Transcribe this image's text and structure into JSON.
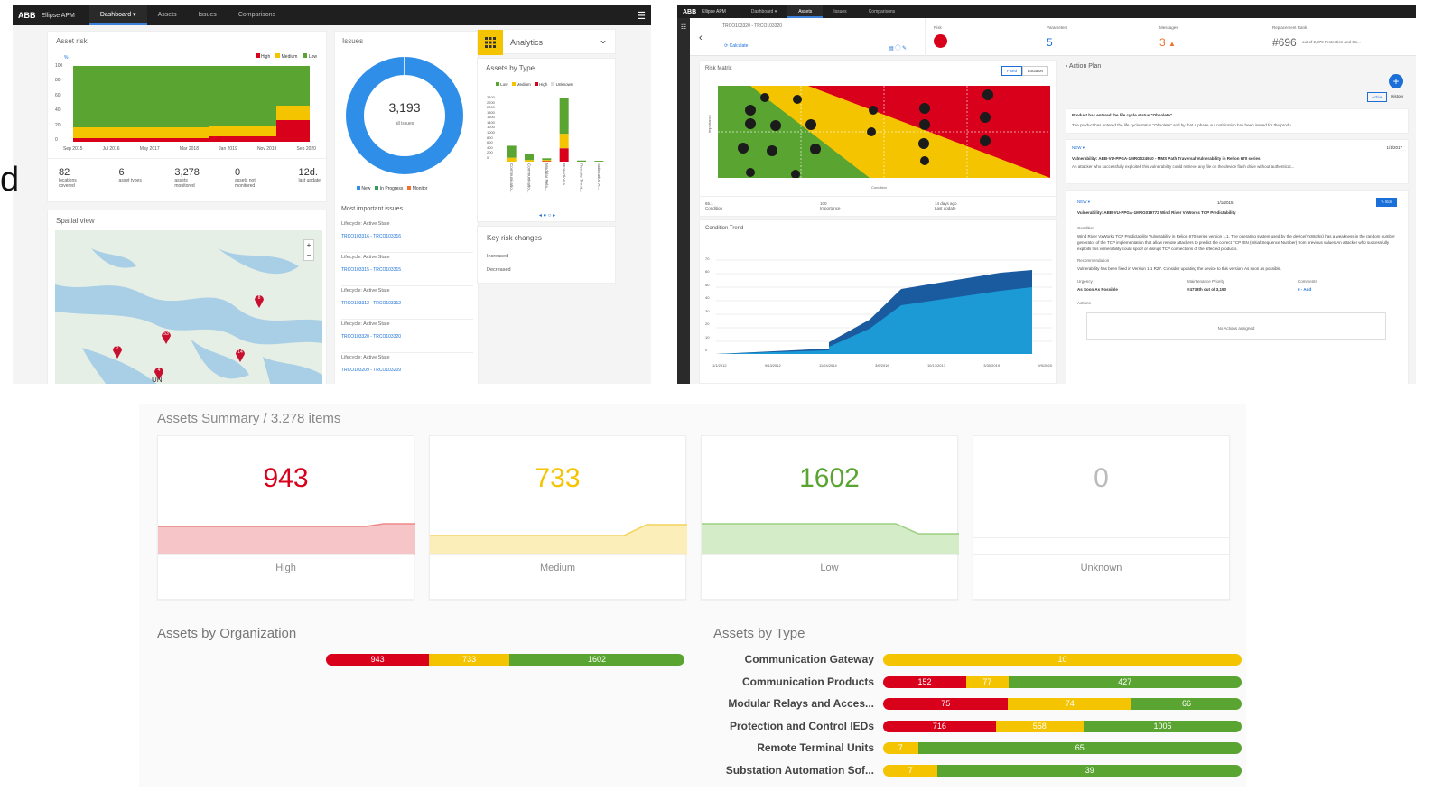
{
  "left": {
    "nav": {
      "logo": "ABB",
      "app": "Ellipse APM",
      "tabs": [
        "Dashboard ▾",
        "Assets",
        "Issues",
        "Comparisons"
      ],
      "menu": "☰"
    },
    "edge_text": "d",
    "asset_risk": {
      "title": "Asset risk",
      "yunit": "%",
      "legend": [
        "High",
        "Medium",
        "Low"
      ],
      "yticks": [
        "100",
        "80",
        "60",
        "40",
        "20",
        "0"
      ],
      "xticks": [
        "Sep 2015",
        "Jul 2016",
        "May 2017",
        "Mar 2018",
        "Jan 2019",
        "Nov 2019",
        "Sep 2020"
      ]
    },
    "stats": [
      {
        "value": "82",
        "label": "locations covered"
      },
      {
        "value": "6",
        "label": "asset types"
      },
      {
        "value": "3,278",
        "label": "assets monitored"
      },
      {
        "value": "0",
        "label": "assets not monitored"
      },
      {
        "value": "12d.",
        "label": "last update"
      }
    ],
    "spatial": {
      "title": "Spatial view",
      "zoom_in": "+",
      "zoom_out": "−",
      "pins": [
        "8",
        "53",
        "2",
        "14",
        "4"
      ],
      "place": "UNI"
    },
    "issues": {
      "title": "Issues",
      "total": "3,193",
      "total_label": "all issues",
      "legend": [
        "New",
        "In Progress",
        "Monitor"
      ],
      "most_title": "Most important issues",
      "items": [
        {
          "state": "Lifecycle: Active State",
          "id": "TRCO103316 - TRCO103316"
        },
        {
          "state": "Lifecycle: Active State",
          "id": "TRCO103315 - TRCO103315"
        },
        {
          "state": "Lifecycle: Active State",
          "id": "TRCO103312 - TRCO103312"
        },
        {
          "state": "Lifecycle: Active State",
          "id": "TRCO103320 - TRCO103320"
        },
        {
          "state": "Lifecycle: Active State",
          "id": "TRCO103209 - TRCO103209"
        }
      ]
    },
    "analytics": {
      "title": "Analytics",
      "chevron": "⌄"
    },
    "assets_by_type": {
      "title": "Assets by Type",
      "legend": [
        "Low",
        "Medium",
        "High",
        "Unknown"
      ],
      "yticks": [
        "2400",
        "2200",
        "2000",
        "1800",
        "1600",
        "1400",
        "1200",
        "1000",
        "800",
        "600",
        "400",
        "200",
        "0"
      ],
      "xticks": [
        "Communicatio...",
        "Communicatio...",
        "Modular Rela...",
        "Protection a...",
        "Remote Termi...",
        "Substation A..."
      ],
      "pager": "◂ ● ○ ▸"
    },
    "key_risk": {
      "title": "Key risk changes",
      "items": [
        "Increased",
        "Decreased"
      ]
    }
  },
  "right": {
    "nav": {
      "logo": "ABB",
      "app": "Ellipse APM",
      "tabs": [
        "Dashboard ▾",
        "Assets",
        "Issues",
        "Comparisons"
      ]
    },
    "asset_id": "TRCO103320 - TRCO103320",
    "calc": "Calculate",
    "kpis": [
      {
        "label": "Risk",
        "value": ""
      },
      {
        "label": "Parameters",
        "value": "5"
      },
      {
        "label": "Messages",
        "value": "3"
      },
      {
        "label": "Replacement Rank",
        "value": "#696",
        "suffix": "out of 2,379 Protection and Co..."
      }
    ],
    "risk_matrix": {
      "title": "Risk Matrix",
      "btns": [
        "Fixed",
        "Location"
      ],
      "xlabel": "Condition",
      "ylabel": "Importance"
    },
    "mini_stats": [
      {
        "value": "65.1",
        "label": "Condition"
      },
      {
        "value": "100",
        "label": "Importance"
      },
      {
        "value": "14 days ago",
        "label": "Last update"
      }
    ],
    "trend": {
      "title": "Condition Trend",
      "yticks": [
        "70",
        "60",
        "50",
        "40",
        "30",
        "20",
        "10",
        "0"
      ],
      "xticks": [
        "1/1/2012",
        "9/13/2012",
        "11/24/2014",
        "3/6/2016",
        "10/17/2017",
        "3/30/2019",
        "9/9/2020"
      ]
    },
    "action_plan": {
      "title": "Action Plan",
      "tabs": [
        "Active",
        "History"
      ]
    },
    "messages": [
      {
        "title": "Product has entered the life cycle status \"Obsolete\"",
        "body": "The product has entered the life cycle status \"Obsolete\" and by that a phase out notification has been issued for the produ..."
      },
      {
        "tag": "NEW ▾",
        "date": "1/1/2017",
        "title": "Vulnerability: ABB-VU-PPGA-1MRG024910 - MMS Path Traversal Vulnerability in Relion 670 series",
        "body": "An attacker who successfully exploited this vulnerability could retrieve any file on the device flash drive without authenticat..."
      },
      {
        "tag": "NEW ▾",
        "date": "1/1/2015",
        "edit": "✎ Edit",
        "title": "Vulnerability: ABB-VU-PPGA-1MRG019772 Wind River VxWorks TCP Predictability",
        "cond_label": "Condition",
        "cond": "Wind River VxWorks TCP Predictability Vulnerability in Relion 670 series version 1.1. The operating system used by the device(VxWorks) has a weakness in the random number generator of the TCP implementation that allow remote attackers to predict the correct TCP ISN (Initial Sequence Number) from previous values.An attacker who successfully exploits this vulnerability could spoof or disrupt TCP connections of the affected products.",
        "rec_label": "Recommendation",
        "rec": "Vulnerability has been fixed in Version 1.1 R27. Consider updating the device to this version. As soon as possible.",
        "urg_label": "Urgency",
        "urg": "As Soon As Possible",
        "mp_label": "Maintenance Priority",
        "mp": "#4778th out of 3,190",
        "com_label": "Comments",
        "com": "0 - Add",
        "actions_label": "Actions",
        "no_actions": "No Actions assigned"
      }
    ]
  },
  "summary": {
    "title": "Assets Summary / 3.278 items",
    "cards": [
      {
        "value": "943",
        "label": "High",
        "color": "#d9001b"
      },
      {
        "value": "733",
        "label": "Medium",
        "color": "#f5c400"
      },
      {
        "value": "1602",
        "label": "Low",
        "color": "#5aa531"
      },
      {
        "value": "0",
        "label": "Unknown",
        "color": "#bbbbbb"
      }
    ],
    "org_title": "Assets by Organization",
    "org": {
      "high": 943,
      "medium": 733,
      "low": 1602
    },
    "type_title": "Assets by Type",
    "types": [
      {
        "name": "Communication Gateway",
        "high": 0,
        "medium": 10,
        "low": 0
      },
      {
        "name": "Communication Products",
        "high": 152,
        "medium": 77,
        "low": 427
      },
      {
        "name": "Modular Relays and Acces...",
        "high": 75,
        "medium": 74,
        "low": 66
      },
      {
        "name": "Protection and Control IEDs",
        "high": 716,
        "medium": 558,
        "low": 1005
      },
      {
        "name": "Remote Terminal Units",
        "high": 0,
        "medium": 7,
        "low": 65
      },
      {
        "name": "Substation Automation Sof...",
        "high": 0,
        "medium": 7,
        "low": 39
      }
    ]
  },
  "colors": {
    "high": "#d9001b",
    "medium": "#f5c400",
    "low": "#5aa531",
    "blue": "#1a6fd8",
    "issue_blue": "#2f8fe8"
  }
}
